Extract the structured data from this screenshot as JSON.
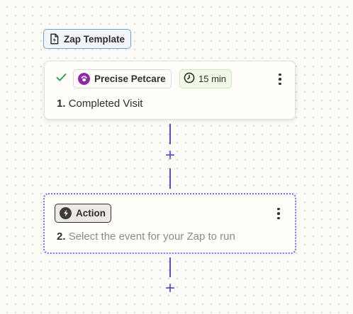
{
  "template_badge": {
    "label": "Zap Template",
    "icon": "zap-template-file-icon"
  },
  "trigger": {
    "status_icon": "check-icon",
    "status_color": "#2e9d4c",
    "app_name": "Precise Petcare",
    "app_icon": "paw-icon",
    "app_color": "#8b2ba3",
    "interval_label": "15 min",
    "interval_icon": "clock-icon",
    "step_number": "1.",
    "step_title": "Completed Visit"
  },
  "connectors": {
    "add_step_label": "+",
    "line_color": "#5b4ccf"
  },
  "action": {
    "badge_label": "Action",
    "badge_icon": "bolt-icon",
    "step_number": "2.",
    "step_title": "Select the event for your Zap to run",
    "border_color": "#7e6ee0"
  }
}
